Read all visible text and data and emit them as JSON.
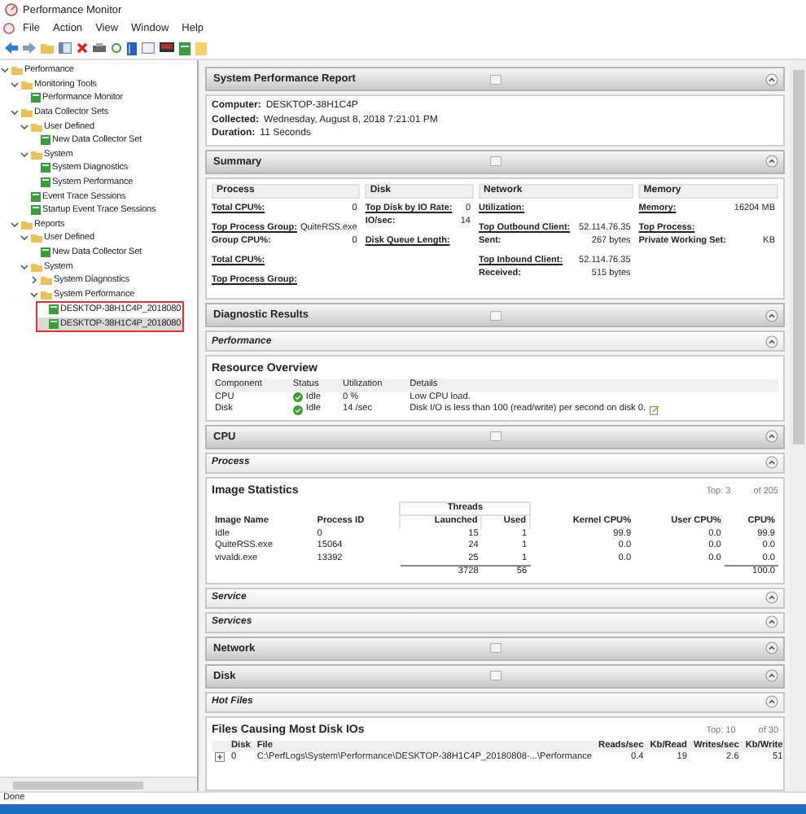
{
  "window": {
    "title": "Performance Monitor"
  },
  "menu": [
    "File",
    "Action",
    "View",
    "Window",
    "Help"
  ],
  "tree": [
    {
      "label": "Performance",
      "expanded": true,
      "selected": false,
      "children": [
        {
          "label": "Monitoring Tools",
          "expanded": true,
          "selected": false,
          "children": [
            {
              "label": "Performance Monitor",
              "selected": false
            }
          ]
        },
        {
          "label": "Data Collector Sets",
          "expanded": true,
          "selected": false,
          "children": [
            {
              "label": "User Defined",
              "expanded": true,
              "selected": false,
              "children": [
                {
                  "label": "New Data Collector Set",
                  "selected": false
                }
              ]
            },
            {
              "label": "System",
              "expanded": true,
              "selected": false,
              "children": [
                {
                  "label": "System Diagnostics",
                  "selected": false
                },
                {
                  "label": "System Performance",
                  "selected": false
                }
              ]
            },
            {
              "label": "Event Trace Sessions",
              "selected": false
            },
            {
              "label": "Startup Event Trace Sessions",
              "selected": false
            }
          ]
        },
        {
          "label": "Reports",
          "expanded": true,
          "selected": false,
          "children": [
            {
              "label": "User Defined",
              "expanded": true,
              "selected": false,
              "children": [
                {
                  "label": "New Data Collector Set",
                  "selected": false
                }
              ]
            },
            {
              "label": "System",
              "expanded": true,
              "selected": false,
              "children": [
                {
                  "label": "System Diagnostics",
                  "expanded": false,
                  "selected": false
                },
                {
                  "label": "System Performance",
                  "expanded": true,
                  "selected": false,
                  "annotated": true,
                  "children": [
                    {
                      "label": "DESKTOP-38H1C4P_2018080",
                      "selected": false
                    },
                    {
                      "label": "DESKTOP-38H1C4P_2018080",
                      "selected": true
                    }
                  ]
                }
              ]
            }
          ]
        }
      ]
    }
  ],
  "report": [
    {
      "kind": "major",
      "title": "System Performance Report"
    },
    {
      "kind": "info",
      "rows": [
        {
          "label": "Computer:",
          "value": "DESKTOP-38H1C4P"
        },
        {
          "label": "Collected:",
          "value": "Wednesday, August 8, 2018 7:21:01 PM"
        },
        {
          "label": "Duration:",
          "value": "11 Seconds"
        }
      ]
    },
    {
      "kind": "major",
      "title": "Summary"
    },
    {
      "kind": "summary",
      "columns": [
        {
          "heading": "Process",
          "groups": [
            [
              {
                "label": "Total CPU%:",
                "value": "0",
                "link": true
              }
            ],
            [
              {
                "label": "Top Process Group:",
                "value": "QuiteRSS.exe",
                "link": true
              },
              {
                "label": "Group CPU%:",
                "value": "0",
                "link": false
              }
            ],
            [
              {
                "label": "Total CPU%:",
                "link": true
              }
            ],
            [
              {
                "label": "Top Process Group:",
                "link": true
              }
            ]
          ]
        },
        {
          "heading": "Disk",
          "groups": [
            [
              {
                "label": "Top Disk by IO Rate:",
                "value": "0",
                "link": true
              },
              {
                "label": "IO/sec:",
                "value": "14",
                "link": false
              }
            ],
            [
              {
                "label": "Disk Queue Length:",
                "link": true
              }
            ]
          ]
        },
        {
          "heading": "Network",
          "groups": [
            [
              {
                "label": "Utilization:",
                "link": true
              }
            ],
            [
              {
                "label": "Top Outbound Client:",
                "value": "52.114.76.35",
                "link": true
              },
              {
                "label": "Sent:",
                "value": "267 bytes",
                "link": false
              }
            ],
            [
              {
                "label": "Top Inbound Client:",
                "value": "52.114.76.35",
                "link": true
              },
              {
                "label": "Received:",
                "value": "515 bytes",
                "link": false
              }
            ]
          ]
        },
        {
          "heading": "Memory",
          "groups": [
            [
              {
                "label": "Memory:",
                "value": "16204 MB",
                "link": true
              }
            ],
            [
              {
                "label": "Top Process:",
                "link": true
              },
              {
                "label": "Private Working Set:",
                "value": "KB",
                "link": false
              }
            ]
          ]
        }
      ]
    },
    {
      "kind": "major",
      "title": "Diagnostic Results"
    },
    {
      "kind": "minor",
      "title": "Performance"
    },
    {
      "kind": "resource",
      "title": "Resource Overview",
      "columns": [
        "Component",
        "Status",
        "Utilization",
        "Details"
      ],
      "rows": [
        {
          "component": "CPU",
          "status": "Idle",
          "utilization": "0 %",
          "details": "Low CPU load.",
          "note": false
        },
        {
          "component": "Disk",
          "status": "Idle",
          "utilization": "14 /sec",
          "details": "Disk I/O is less than 100 (read/write) per second on disk 0.",
          "note": true
        }
      ]
    },
    {
      "kind": "major",
      "title": "CPU"
    },
    {
      "kind": "minor",
      "title": "Process"
    },
    {
      "kind": "images",
      "title": "Image Statistics",
      "top": "Top: 3",
      "of": "of 205",
      "group_label": "Threads",
      "columns": [
        {
          "label": "Image Name",
          "in_group": false
        },
        {
          "label": "Process ID",
          "in_group": false
        },
        {
          "label": "Launched",
          "in_group": true
        },
        {
          "label": "Used",
          "in_group": true
        },
        {
          "label": "Kernel CPU%",
          "in_group": false
        },
        {
          "label": "User CPU%",
          "in_group": false
        },
        {
          "label": "CPU%",
          "in_group": false
        }
      ],
      "rows": [
        [
          "Idle",
          "0",
          "15",
          "1",
          "99.9",
          "0.0",
          "99.9"
        ],
        [
          "QuiteRSS.exe",
          "15064",
          "24",
          "1",
          "0.0",
          "0.0",
          "0.0"
        ],
        [
          "vivaldi.exe",
          "13392",
          "25",
          "1",
          "0.0",
          "0.0",
          "0.0"
        ]
      ],
      "totals": {
        "launched": "3728",
        "used": "56",
        "cpu": "100.0"
      }
    },
    {
      "kind": "minor",
      "title": "Service"
    },
    {
      "kind": "minor",
      "title": "Services"
    },
    {
      "kind": "major",
      "title": "Network"
    },
    {
      "kind": "major",
      "title": "Disk"
    },
    {
      "kind": "minor",
      "title": "Hot Files"
    },
    {
      "kind": "files",
      "title": "Files Causing Most Disk IOs",
      "top": "Top: 10",
      "of": "of 30",
      "columns": [
        "Disk",
        "File",
        "Reads/sec",
        "Kb/Read",
        "Writes/sec",
        "Kb/Write"
      ],
      "rows": [
        [
          "0",
          "C:\\PerfLogs\\System\\Performance\\DESKTOP-38H1C4P_20180808-...\\Performance",
          "0.4",
          "19",
          "2.6",
          "51"
        ]
      ]
    }
  ],
  "status_bar": "Done"
}
